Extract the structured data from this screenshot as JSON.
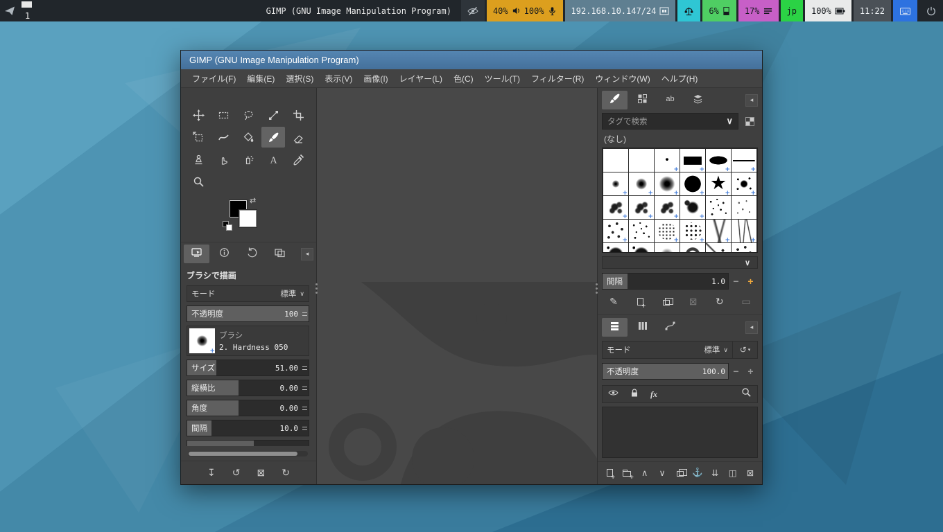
{
  "colors": {
    "titlebar": "#4e7ca9",
    "statusbar_bg": "#21262b",
    "seg_audio": "#dc9f1e",
    "seg_network": "#5f7f91",
    "seg_scale": "#2fc6d4",
    "seg_cpu": "#4fce63",
    "seg_memory": "#c75fc7",
    "seg_layout": "#2bd245",
    "seg_battery": "#e9eaea",
    "seg_clock": "#4b5157",
    "seg_keyboard": "#2d72e0"
  },
  "statusbar": {
    "workspace": "1",
    "title": "GIMP (GNU Image Manipulation Program)",
    "volume": "40%",
    "mic_volume": "100%",
    "network": "192.168.10.147/24",
    "cpu": "6%",
    "memory": "17%",
    "keyboard_layout": "jp",
    "battery": "100%",
    "time": "11:22"
  },
  "icons": {
    "chevron_down": "∨",
    "swap_colors": "⇄",
    "save_preset": "↧",
    "restore_preset": "↺",
    "delete_preset": "⊠",
    "reset_preset": "↻",
    "edit_brush": "✎",
    "delete_brush": "⊠",
    "refresh_brushes": "↻",
    "open_brush": "▭",
    "minus": "−",
    "plus": "+",
    "raise": "∧",
    "lower": "∨",
    "anchor": "⚓",
    "merge_down": "⇊",
    "add_mask": "◫",
    "delete_layer": "⊠",
    "dock_menu": "◂",
    "mode_reset": "↺",
    "mode_caret": "▾"
  },
  "gimp": {
    "window_title": "GIMP (GNU Image Manipulation Program)",
    "menu_items": [
      "ファイル(F)",
      "編集(E)",
      "選択(S)",
      "表示(V)",
      "画像(I)",
      "レイヤー(L)",
      "色(C)",
      "ツール(T)",
      "フィルター(R)",
      "ウィンドウ(W)",
      "ヘルプ(H)"
    ],
    "toolbox": {
      "foreground_color": "#000000",
      "background_color": "#ffffff",
      "tools": [
        {
          "id": "move",
          "active": false
        },
        {
          "id": "rectangle-select",
          "active": false
        },
        {
          "id": "free-select",
          "active": false
        },
        {
          "id": "paths",
          "active": false
        },
        {
          "id": "crop",
          "active": false
        },
        {
          "id": "transform",
          "active": false
        },
        {
          "id": "warp-transform",
          "active": false
        },
        {
          "id": "bucket-fill",
          "active": false
        },
        {
          "id": "paintbrush",
          "active": true
        },
        {
          "id": "eraser",
          "active": false
        },
        {
          "id": "clone",
          "active": false
        },
        {
          "id": "smudge",
          "active": false
        },
        {
          "id": "airbrush",
          "active": false
        },
        {
          "id": "text",
          "active": false
        },
        {
          "id": "color-picker",
          "active": false
        },
        {
          "id": "zoom",
          "active": false
        }
      ]
    },
    "tool_options": {
      "title": "ブラシで描画",
      "mode_label": "モード",
      "mode_value": "標準",
      "opacity_label": "不透明度",
      "opacity_value": "100",
      "opacity_fill_pct": 100,
      "brush_label": "ブラシ",
      "brush_name": "2. Hardness 050",
      "sliders": [
        {
          "label": "サイズ",
          "value": "51.00",
          "fill_pct": 24
        },
        {
          "label": "縦横比",
          "value": "0.00",
          "fill_pct": 42
        },
        {
          "label": "角度",
          "value": "0.00",
          "fill_pct": 42
        },
        {
          "label": "間隔",
          "value": "10.0",
          "fill_pct": 20
        }
      ]
    },
    "brushes_panel": {
      "search_placeholder": "タグで検索",
      "tag_filter": "(なし)",
      "spacing_label": "間隔",
      "spacing_value": "1.0",
      "spacing_fill_pct": 20,
      "grid": [
        {
          "shape": "blank",
          "plus": false
        },
        {
          "shape": "blank",
          "plus": false
        },
        {
          "shape": "micro-dot",
          "plus": true
        },
        {
          "shape": "bar",
          "plus": true
        },
        {
          "shape": "ellipse",
          "plus": true
        },
        {
          "shape": "hline",
          "plus": true
        },
        {
          "shape": "soft-small",
          "plus": true
        },
        {
          "shape": "soft-medium",
          "plus": true
        },
        {
          "shape": "soft-large",
          "plus": true
        },
        {
          "shape": "disc",
          "plus": true
        },
        {
          "shape": "star",
          "plus": true
        },
        {
          "shape": "splat",
          "plus": true
        },
        {
          "shape": "chalk",
          "plus": true
        },
        {
          "shape": "chalk2",
          "plus": true
        },
        {
          "shape": "chalk3",
          "plus": true
        },
        {
          "shape": "chalk-dark",
          "plus": true
        },
        {
          "shape": "specks",
          "plus": false
        },
        {
          "shape": "specks-light",
          "plus": false
        },
        {
          "shape": "scatter",
          "plus": true
        },
        {
          "shape": "specks-dense",
          "plus": false
        },
        {
          "shape": "granite",
          "plus": true
        },
        {
          "shape": "cells",
          "plus": true
        },
        {
          "shape": "wisp",
          "plus": true
        },
        {
          "shape": "grass",
          "plus": true
        },
        {
          "shape": "dark-texture",
          "plus": false
        },
        {
          "shape": "dark-texture2",
          "plus": false
        },
        {
          "shape": "haze",
          "plus": false
        },
        {
          "shape": "swirl",
          "plus": false
        },
        {
          "shape": "vine",
          "plus": true
        },
        {
          "shape": "confetti",
          "plus": true
        }
      ]
    },
    "layers_panel": {
      "mode_label": "モード",
      "mode_value": "標準",
      "opacity_label": "不透明度",
      "opacity_value": "100.0",
      "opacity_fill_pct": 100,
      "fx_label": "fx"
    }
  }
}
